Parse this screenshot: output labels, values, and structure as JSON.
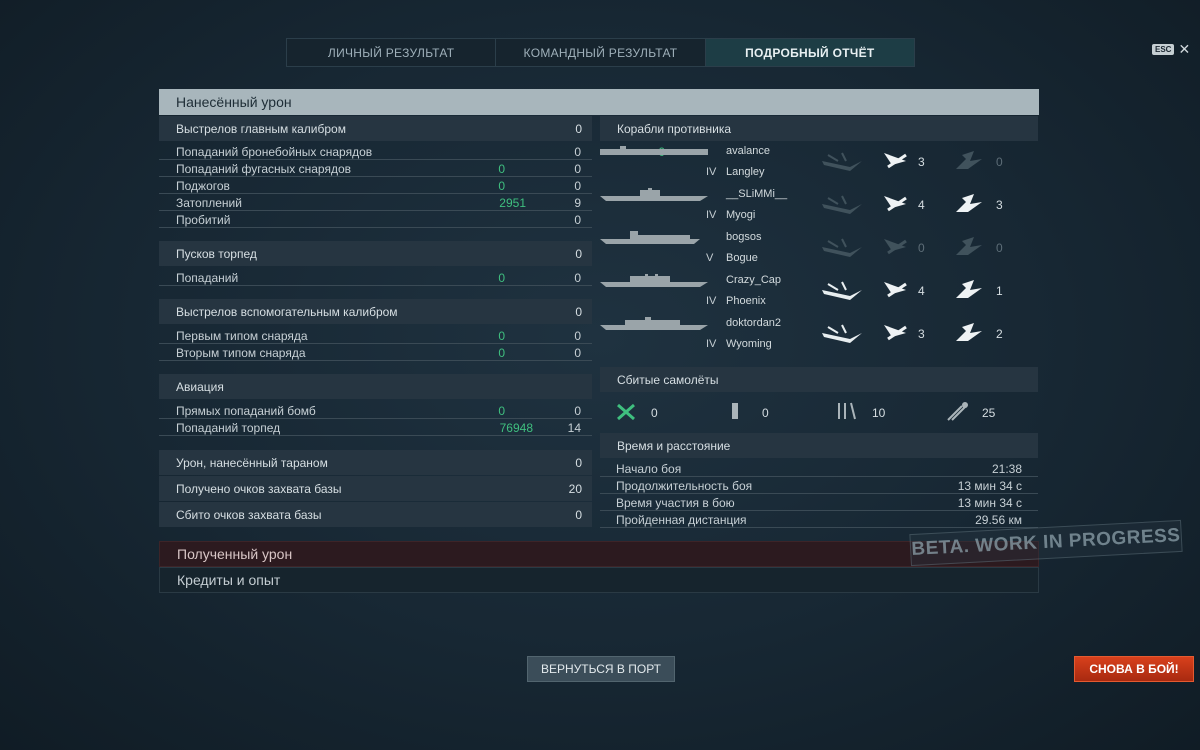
{
  "tabs": [
    "ЛИЧНЫЙ РЕЗУЛЬТАТ",
    "КОМАНДНЫЙ РЕЗУЛЬТАТ",
    "ПОДРОБНЫЙ ОТЧЁТ"
  ],
  "esc": {
    "key": "ESC",
    "close": "✕"
  },
  "damage_section": "Нанесённый урон",
  "main_battery": {
    "title": "Выстрелов главным калибром",
    "value": "0",
    "rows": [
      {
        "label": "Попаданий бронебойных снарядов",
        "green": "0",
        "value": "0"
      },
      {
        "label": "Попаданий фугасных снарядов",
        "green": "0",
        "value": "0"
      },
      {
        "label": "Поджогов",
        "green": "0",
        "value": "0"
      },
      {
        "label": "Затоплений",
        "green": "2951",
        "value": "9"
      },
      {
        "label": "Пробитий",
        "green": "",
        "value": "0"
      }
    ]
  },
  "torpedoes": {
    "title": "Пусков торпед",
    "value": "0",
    "rows": [
      {
        "label": "Попаданий",
        "green": "0",
        "value": "0"
      }
    ]
  },
  "secondary": {
    "title": "Выстрелов вспомогательным калибром",
    "value": "0",
    "rows": [
      {
        "label": "Первым типом снаряда",
        "green": "0",
        "value": "0"
      },
      {
        "label": "Вторым типом снаряда",
        "green": "0",
        "value": "0"
      }
    ]
  },
  "aviation": {
    "title": "Авиация",
    "rows": [
      {
        "label": "Прямых попаданий бомб",
        "green": "0",
        "value": "0"
      },
      {
        "label": "Попаданий торпед",
        "green": "76948",
        "value": "14"
      }
    ]
  },
  "ram": {
    "title": "Урон, нанесённый тараном",
    "value": "0"
  },
  "capture": {
    "title": "Получено очков захвата базы",
    "value": "20"
  },
  "defend": {
    "title": "Сбито очков захвата базы",
    "value": "0"
  },
  "enemy_ships": {
    "title": "Корабли противника",
    "ships": [
      {
        "player": "avalance",
        "tier": "IV",
        "name": "Langley",
        "torp": "3",
        "bomb": "0",
        "sunk": false
      },
      {
        "player": "__SLiMMi__",
        "tier": "IV",
        "name": "Myogi",
        "torp": "4",
        "bomb": "3",
        "sunk": false
      },
      {
        "player": "bogsos",
        "tier": "V",
        "name": "Bogue",
        "torp": "0",
        "bomb": "0",
        "sunk": false
      },
      {
        "player": "Crazy_Cap",
        "tier": "IV",
        "name": "Phoenix",
        "torp": "4",
        "bomb": "1",
        "sunk": true
      },
      {
        "player": "doktordan2",
        "tier": "IV",
        "name": "Wyoming",
        "torp": "3",
        "bomb": "2",
        "sunk": true
      }
    ]
  },
  "planes": {
    "title": "Сбитые самолёты",
    "items": [
      {
        "icon": "fighter-icon",
        "value": "0"
      },
      {
        "icon": "bomber-icon",
        "value": "0"
      },
      {
        "icon": "torpedo-bomber-icon",
        "value": "10"
      },
      {
        "icon": "dive-bomber-icon",
        "value": "25"
      }
    ]
  },
  "time": {
    "title": "Время и расстояние",
    "rows": [
      {
        "label": "Начало боя",
        "value": "21:38"
      },
      {
        "label": "Продолжительность боя",
        "value": "13 мин 34 с"
      },
      {
        "label": "Время участия в бою",
        "value": "13 мин 34 с"
      },
      {
        "label": "Пройденная дистанция",
        "value": "29.56 км"
      }
    ]
  },
  "received_section": "Полученный урон",
  "credits_section": "Кредиты и опыт",
  "buttons": {
    "port": "ВЕРНУТЬСЯ В ПОРТ",
    "battle": "СНОВА В БОЙ!"
  },
  "watermark": "BETA. WORK IN PROGRESS"
}
